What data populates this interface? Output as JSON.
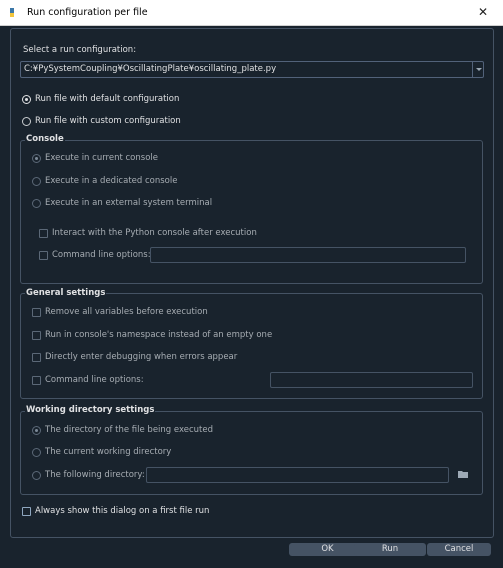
{
  "window": {
    "title": "Run configuration per file",
    "close_glyph": "✕"
  },
  "select_label": "Select a run configuration:",
  "selected_config": "C:¥PySystemCoupling¥OscillatingPlate¥oscillating_plate.py",
  "mode": {
    "default": "Run file with default configuration",
    "custom": "Run file with custom configuration",
    "selected": "default"
  },
  "console": {
    "title": "Console",
    "current": "Execute in current console",
    "dedicated": "Execute in a dedicated console",
    "external": "Execute in an external system terminal",
    "interact": "Interact with the Python console after execution",
    "cmd_label": "Command line options:"
  },
  "general": {
    "title": "General settings",
    "remove_vars": "Remove all variables before execution",
    "namespace": "Run in console's namespace instead of an empty one",
    "debug": "Directly enter debugging when errors appear",
    "cmd_label": "Command line options:"
  },
  "workdir": {
    "title": "Working directory settings",
    "file_dir": "The directory of the file being executed",
    "cwd": "The current working directory",
    "following": "The following directory:"
  },
  "always_show": "Always show this dialog on a first file run",
  "buttons": {
    "ok": "OK",
    "run": "Run",
    "cancel": "Cancel"
  },
  "icons": {
    "app": "python-icon",
    "folder": "folder-icon",
    "close": "close-icon"
  },
  "colors": {
    "background": "#19232d",
    "border": "#455364",
    "button": "#455364",
    "text": "#e0e1e3"
  }
}
